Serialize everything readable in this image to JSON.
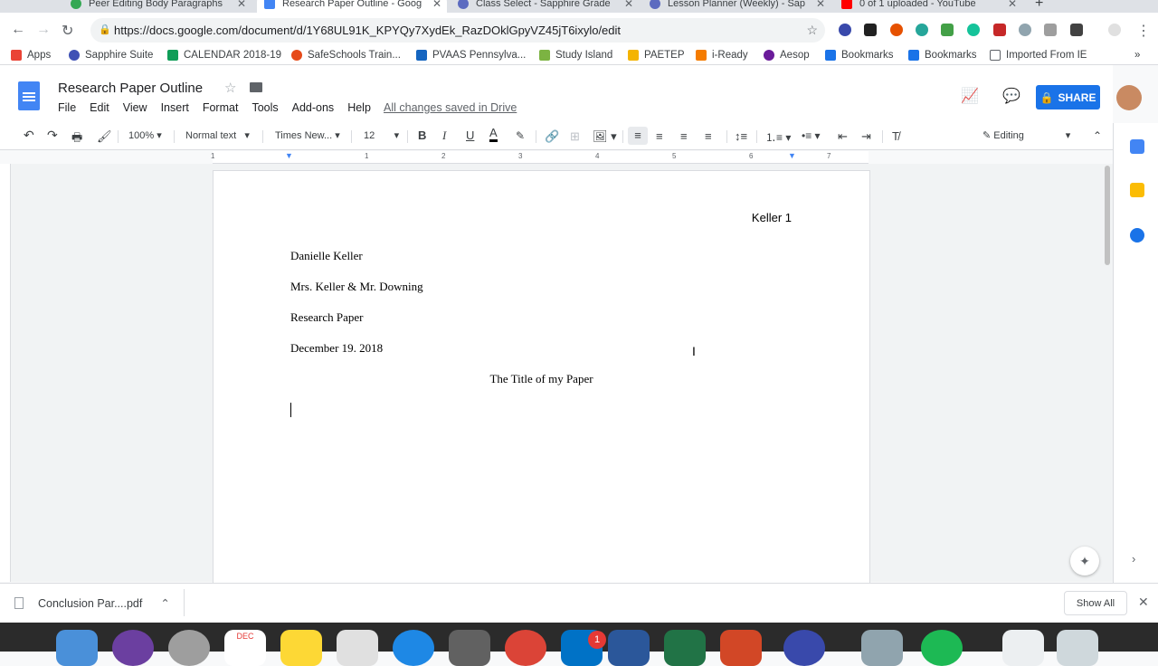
{
  "browser": {
    "tabs": [
      {
        "label": "Peer Editing Body Paragraphs",
        "color": "#34a853"
      },
      {
        "label": "Research Paper Outline - Goog",
        "color": "#4285f4"
      },
      {
        "label": "Class Select - Sapphire Grade",
        "color": "#5c6bc0"
      },
      {
        "label": "Lesson Planner (Weekly) - Sap",
        "color": "#5c6bc0"
      },
      {
        "label": "0 of 1 uploaded - YouTube",
        "color": "#ff0000"
      }
    ],
    "new_tab": "+",
    "url": "https://docs.google.com/document/d/1Y68UL91K_KPYQy7XydEk_RazDOklGpyVZ45jT6ixylo/edit"
  },
  "bookmarks": [
    {
      "label": "Apps",
      "color": "#ea4335"
    },
    {
      "label": "Sapphire Suite",
      "color": "#3f51b5"
    },
    {
      "label": "CALENDAR 2018-19",
      "color": "#0f9d58"
    },
    {
      "label": "SafeSchools Train...",
      "color": "#e64a19"
    },
    {
      "label": "PVAAS Pennsylva...",
      "color": "#1565c0"
    },
    {
      "label": "Study Island",
      "color": "#7cb342"
    },
    {
      "label": "PAETEP",
      "color": "#f4b400"
    },
    {
      "label": "i-Ready",
      "color": "#f57c00"
    },
    {
      "label": "Aesop",
      "color": "#6a1b9a"
    },
    {
      "label": "Bookmarks",
      "color": "#1a73e8"
    },
    {
      "label": "Bookmarks",
      "color": "#1a73e8"
    },
    {
      "label": "Imported From IE",
      "color": "#5f6368"
    }
  ],
  "doc": {
    "title": "Research Paper Outline",
    "menu": [
      "File",
      "Edit",
      "View",
      "Insert",
      "Format",
      "Tools",
      "Add-ons",
      "Help"
    ],
    "saved_status": "All changes saved in Drive",
    "share_label": "SHARE"
  },
  "toolbar": {
    "zoom": "100%",
    "style": "Normal text",
    "font": "Times New...",
    "size": "12",
    "mode": "Editing"
  },
  "ruler_numbers": [
    "1",
    "1",
    "2",
    "3",
    "4",
    "5",
    "6",
    "7"
  ],
  "page": {
    "header": "Keller 1",
    "lines": [
      "Danielle Keller",
      "Mrs. Keller & Mr. Downing",
      "Research Paper",
      "December 19. 2018"
    ],
    "title": "The Title of my Paper"
  },
  "downloads": {
    "file": "Conclusion Par....pdf",
    "show_all": "Show All"
  },
  "dock": {
    "badge": "1",
    "calendar_month": "DEC"
  }
}
